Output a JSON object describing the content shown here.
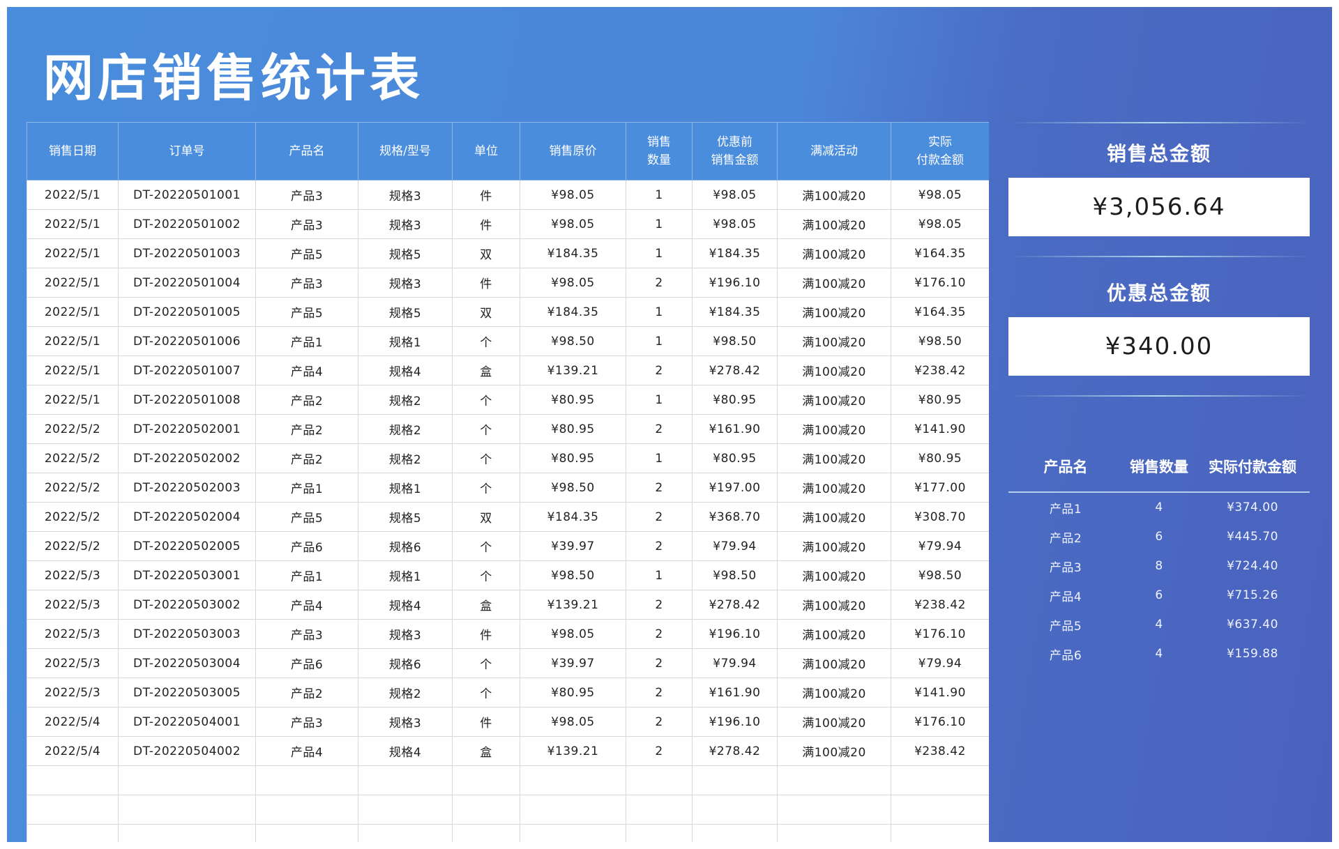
{
  "title": "网店销售统计表",
  "colors": {
    "header_blue": "#4a8ddc",
    "panel_blue": "#4a62be",
    "white": "#ffffff"
  },
  "table": {
    "headers": [
      [
        "销售日期"
      ],
      [
        "订单号"
      ],
      [
        "产品名"
      ],
      [
        "规格/型号"
      ],
      [
        "单位"
      ],
      [
        "销售原价"
      ],
      [
        "销售",
        "数量"
      ],
      [
        "优惠前",
        "销售金额"
      ],
      [
        "满减活动"
      ],
      [
        "实际",
        "付款金额"
      ]
    ],
    "rows": [
      [
        "2022/5/1",
        "DT-20220501001",
        "产品3",
        "规格3",
        "件",
        "¥98.05",
        "1",
        "¥98.05",
        "满100减20",
        "¥98.05"
      ],
      [
        "2022/5/1",
        "DT-20220501002",
        "产品3",
        "规格3",
        "件",
        "¥98.05",
        "1",
        "¥98.05",
        "满100减20",
        "¥98.05"
      ],
      [
        "2022/5/1",
        "DT-20220501003",
        "产品5",
        "规格5",
        "双",
        "¥184.35",
        "1",
        "¥184.35",
        "满100减20",
        "¥164.35"
      ],
      [
        "2022/5/1",
        "DT-20220501004",
        "产品3",
        "规格3",
        "件",
        "¥98.05",
        "2",
        "¥196.10",
        "满100减20",
        "¥176.10"
      ],
      [
        "2022/5/1",
        "DT-20220501005",
        "产品5",
        "规格5",
        "双",
        "¥184.35",
        "1",
        "¥184.35",
        "满100减20",
        "¥164.35"
      ],
      [
        "2022/5/1",
        "DT-20220501006",
        "产品1",
        "规格1",
        "个",
        "¥98.50",
        "1",
        "¥98.50",
        "满100减20",
        "¥98.50"
      ],
      [
        "2022/5/1",
        "DT-20220501007",
        "产品4",
        "规格4",
        "盒",
        "¥139.21",
        "2",
        "¥278.42",
        "满100减20",
        "¥238.42"
      ],
      [
        "2022/5/1",
        "DT-20220501008",
        "产品2",
        "规格2",
        "个",
        "¥80.95",
        "1",
        "¥80.95",
        "满100减20",
        "¥80.95"
      ],
      [
        "2022/5/2",
        "DT-20220502001",
        "产品2",
        "规格2",
        "个",
        "¥80.95",
        "2",
        "¥161.90",
        "满100减20",
        "¥141.90"
      ],
      [
        "2022/5/2",
        "DT-20220502002",
        "产品2",
        "规格2",
        "个",
        "¥80.95",
        "1",
        "¥80.95",
        "满100减20",
        "¥80.95"
      ],
      [
        "2022/5/2",
        "DT-20220502003",
        "产品1",
        "规格1",
        "个",
        "¥98.50",
        "2",
        "¥197.00",
        "满100减20",
        "¥177.00"
      ],
      [
        "2022/5/2",
        "DT-20220502004",
        "产品5",
        "规格5",
        "双",
        "¥184.35",
        "2",
        "¥368.70",
        "满100减20",
        "¥308.70"
      ],
      [
        "2022/5/2",
        "DT-20220502005",
        "产品6",
        "规格6",
        "个",
        "¥39.97",
        "2",
        "¥79.94",
        "满100减20",
        "¥79.94"
      ],
      [
        "2022/5/3",
        "DT-20220503001",
        "产品1",
        "规格1",
        "个",
        "¥98.50",
        "1",
        "¥98.50",
        "满100减20",
        "¥98.50"
      ],
      [
        "2022/5/3",
        "DT-20220503002",
        "产品4",
        "规格4",
        "盒",
        "¥139.21",
        "2",
        "¥278.42",
        "满100减20",
        "¥238.42"
      ],
      [
        "2022/5/3",
        "DT-20220503003",
        "产品3",
        "规格3",
        "件",
        "¥98.05",
        "2",
        "¥196.10",
        "满100减20",
        "¥176.10"
      ],
      [
        "2022/5/3",
        "DT-20220503004",
        "产品6",
        "规格6",
        "个",
        "¥39.97",
        "2",
        "¥79.94",
        "满100减20",
        "¥79.94"
      ],
      [
        "2022/5/3",
        "DT-20220503005",
        "产品2",
        "规格2",
        "个",
        "¥80.95",
        "2",
        "¥161.90",
        "满100减20",
        "¥141.90"
      ],
      [
        "2022/5/4",
        "DT-20220504001",
        "产品3",
        "规格3",
        "件",
        "¥98.05",
        "2",
        "¥196.10",
        "满100减20",
        "¥176.10"
      ],
      [
        "2022/5/4",
        "DT-20220504002",
        "产品4",
        "规格4",
        "盒",
        "¥139.21",
        "2",
        "¥278.42",
        "满100减20",
        "¥238.42"
      ]
    ],
    "empty_rows": 3
  },
  "side": {
    "total_sales_label": "销售总金额",
    "total_sales_value": "¥3,056.64",
    "total_discount_label": "优惠总金额",
    "total_discount_value": "¥340.00",
    "summary_headers": [
      "产品名",
      "销售数量",
      "实际付款金额"
    ],
    "summary_rows": [
      [
        "产品1",
        "4",
        "¥374.00"
      ],
      [
        "产品2",
        "6",
        "¥445.70"
      ],
      [
        "产品3",
        "8",
        "¥724.40"
      ],
      [
        "产品4",
        "6",
        "¥715.26"
      ],
      [
        "产品5",
        "4",
        "¥637.40"
      ],
      [
        "产品6",
        "4",
        "¥159.88"
      ]
    ]
  }
}
